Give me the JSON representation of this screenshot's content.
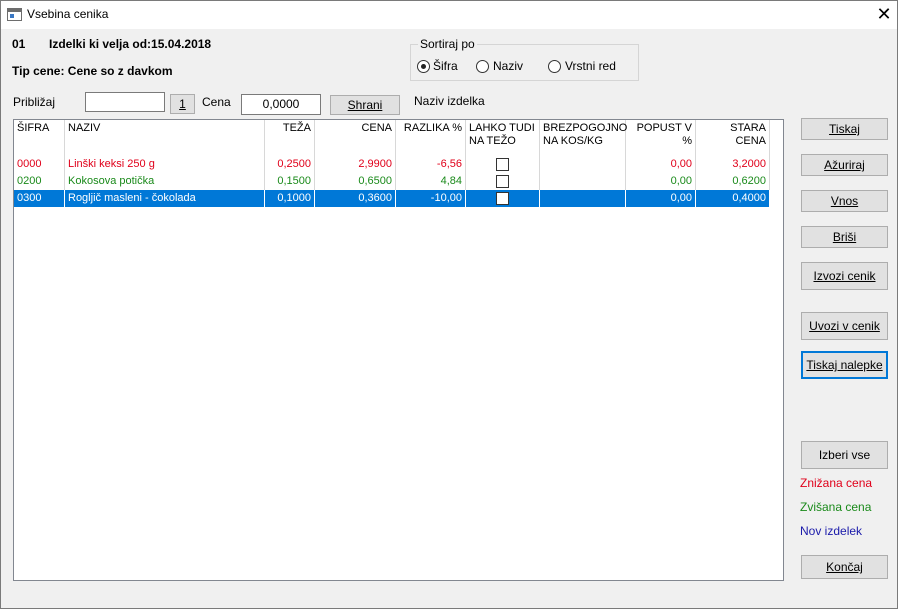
{
  "window": {
    "title": "Vsebina cenika"
  },
  "header": {
    "code": "01",
    "valid_label": "Izdelki ki velja od:15.04.2018",
    "price_type": "Tip cene: Cene so z davkom"
  },
  "sort": {
    "legend": "Sortiraj po",
    "options": [
      "Šifra",
      "Naziv",
      "Vrstni red"
    ],
    "selected": "Šifra"
  },
  "search": {
    "approx_label": "Približaj",
    "approx_value": "",
    "one_button": "1",
    "price_label": "Cena",
    "price_value": "0,0000",
    "save_button": "Shrani",
    "product_name_label": "Naziv izdelka"
  },
  "table": {
    "columns": [
      "ŠIFRA",
      "NAZIV",
      "TEŽA",
      "CENA",
      "RAZLIKA %",
      "LAHKO TUDI NA TEŽO",
      "BREZPOGOJNO NA KOS/KG",
      "POPUST V %",
      "STARA CENA"
    ],
    "rows": [
      {
        "sifra": "0000",
        "naziv": "Linški keksi 250 g",
        "teza": "0,2500",
        "cena": "2,9900",
        "razlika": "-6,56",
        "lahko": false,
        "brezpogojno": "",
        "popust": "0,00",
        "stara": "3,2000",
        "status": "discount",
        "selected": false
      },
      {
        "sifra": "0200",
        "naziv": "Kokosova potička",
        "teza": "0,1500",
        "cena": "0,6500",
        "razlika": "4,84",
        "lahko": false,
        "brezpogojno": "",
        "popust": "0,00",
        "stara": "0,6200",
        "status": "increase",
        "selected": false
      },
      {
        "sifra": "0300",
        "naziv": "Rogljič masleni - čokolada",
        "teza": "0,1000",
        "cena": "0,3600",
        "razlika": "-10,00",
        "lahko": false,
        "brezpogojno": "",
        "popust": "0,00",
        "stara": "0,4000",
        "status": "new",
        "selected": true
      }
    ]
  },
  "buttons": {
    "tiskaj": "Tiskaj",
    "azuriraj": "Ažuriraj",
    "vnos": "Vnos",
    "brisi": "Briši",
    "izvozi": "Izvozi cenik",
    "uvozi": "Uvozi v cenik",
    "nalepke": "Tiskaj nalepke",
    "izberi": "Izberi vse",
    "koncaj": "Končaj"
  },
  "legend": {
    "discount": "Znižana cena",
    "increase": "Zvišana cena",
    "new": "Nov izdelek"
  },
  "colors": {
    "discount": "#e0001a",
    "increase": "#1a8a1a",
    "new": "#1a1aaa",
    "selection": "#0078d7"
  }
}
